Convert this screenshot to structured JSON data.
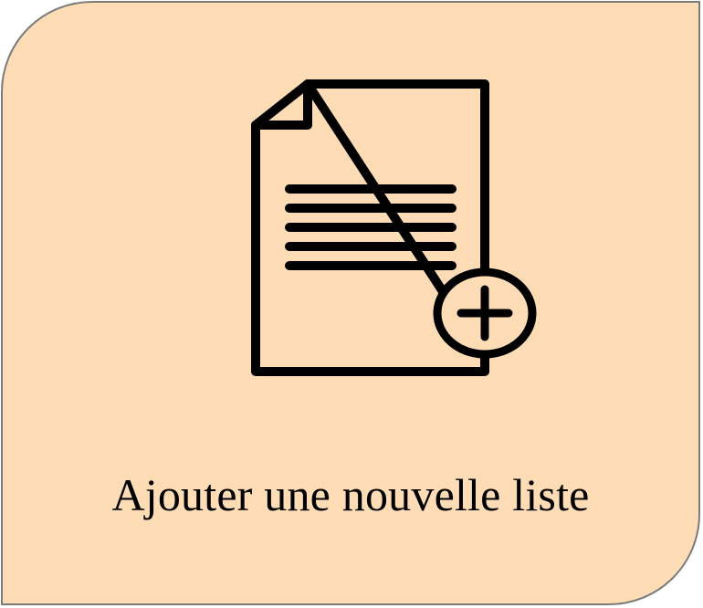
{
  "tile": {
    "label": "Ajouter une nouvelle liste",
    "icon": "add-document-icon",
    "background_color": "#fddcb6",
    "border_color": "#7a7a7a"
  }
}
